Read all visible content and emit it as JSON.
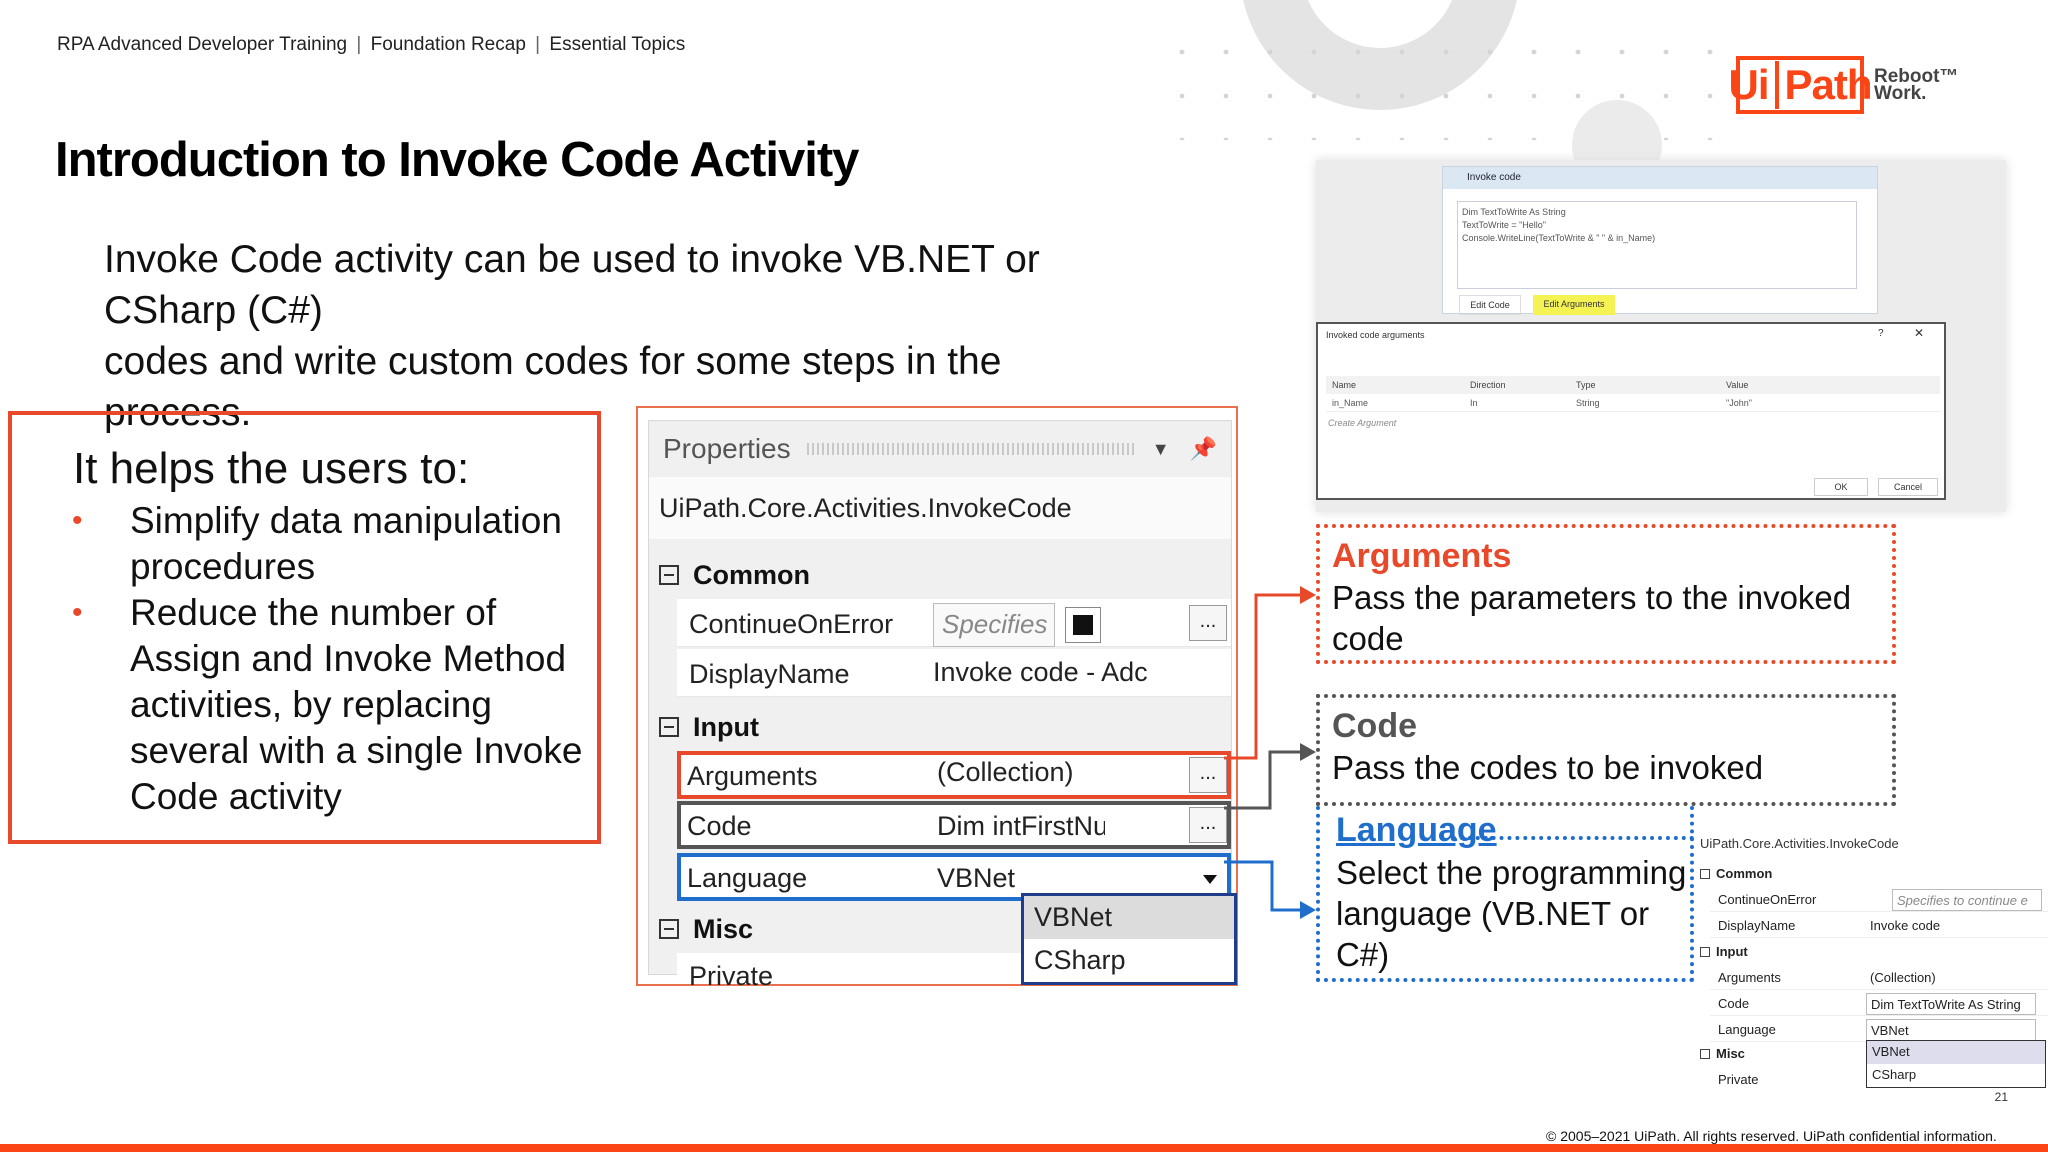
{
  "header": {
    "course": "RPA Advanced Developer Training",
    "section": "Foundation Recap",
    "topic": "Essential Topics",
    "separator": "|"
  },
  "logo": {
    "ui": "Ui",
    "path": "Path",
    "tagline_1": "Reboot™",
    "tagline_2": "Work."
  },
  "title": "Introduction to Invoke Code Activity",
  "intro": {
    "line1": "Invoke Code activity can be used to invoke VB.NET or CSharp (C#)",
    "line2": "codes and write custom codes for some steps in the process."
  },
  "helps": {
    "heading": "It helps the users to:",
    "bullets": [
      "Simplify data manipulation procedures",
      "Reduce the number of Assign and Invoke Method activities, by replacing several with a single Invoke Code activity"
    ],
    "bullet_glyph": "•"
  },
  "properties": {
    "title": "Properties",
    "type": "UiPath.Core.Activities.InvokeCode",
    "ellipsis": "...",
    "categories": {
      "common": "Common",
      "input": "Input",
      "misc": "Misc"
    },
    "rows": {
      "continue_on_error": {
        "name": "ContinueOnError",
        "value": "Specifies"
      },
      "display_name": {
        "name": "DisplayName",
        "value": "Invoke code - Adc"
      },
      "arguments": {
        "name": "Arguments",
        "value": "(Collection)"
      },
      "code": {
        "name": "Code",
        "value": "Dim intFirstNu"
      },
      "language": {
        "name": "Language",
        "value": "VBNet"
      },
      "private": {
        "name": "Private",
        "value": ""
      }
    },
    "language_options": [
      "VBNet",
      "CSharp"
    ],
    "colors": {
      "arguments": "#e8492a",
      "code": "#555555",
      "language": "#1f6ecb"
    }
  },
  "callouts": {
    "arguments": {
      "heading": "Arguments",
      "body": "Pass the parameters to the invoked code"
    },
    "code": {
      "heading": "Code",
      "body": "Pass the codes to be invoked"
    },
    "language": {
      "heading": "Language",
      "body": "Select the programming language (VB.NET or C#)"
    }
  },
  "screenshot_top": {
    "activity_title": "Invoke code",
    "code_lines": [
      "Dim TextToWrite As String",
      "TextToWrite = \"Hello\"",
      "Console.WriteLine(TextToWrite & \" \" & in_Name)"
    ],
    "edit_code": "Edit Code",
    "edit_arguments": "Edit Arguments",
    "dialog_title": "Invoked code arguments",
    "help": "?",
    "close": "✕",
    "columns": [
      "Name",
      "Direction",
      "Type",
      "Value"
    ],
    "row": [
      "in_Name",
      "In",
      "String",
      "\"John\""
    ],
    "create_argument": "Create Argument",
    "ok": "OK",
    "cancel": "Cancel"
  },
  "screenshot_bottom": {
    "type": "UiPath.Core.Activities.InvokeCode",
    "common": "Common",
    "continue_on_error": "ContinueOnError",
    "continue_value": "Specifies to continue e",
    "display_name": "DisplayName",
    "display_value": "Invoke code",
    "input": "Input",
    "arguments": "Arguments",
    "arguments_value": "(Collection)",
    "code": "Code",
    "code_value": "Dim TextToWrite As String",
    "language": "Language",
    "language_value": "VBNet",
    "misc": "Misc",
    "private": "Private",
    "options": [
      "VBNet",
      "CSharp"
    ],
    "page": "21"
  },
  "footer": "© 2005–2021 UiPath. All rights reserved. UiPath confidential information.",
  "brand_color": "#fa4616"
}
